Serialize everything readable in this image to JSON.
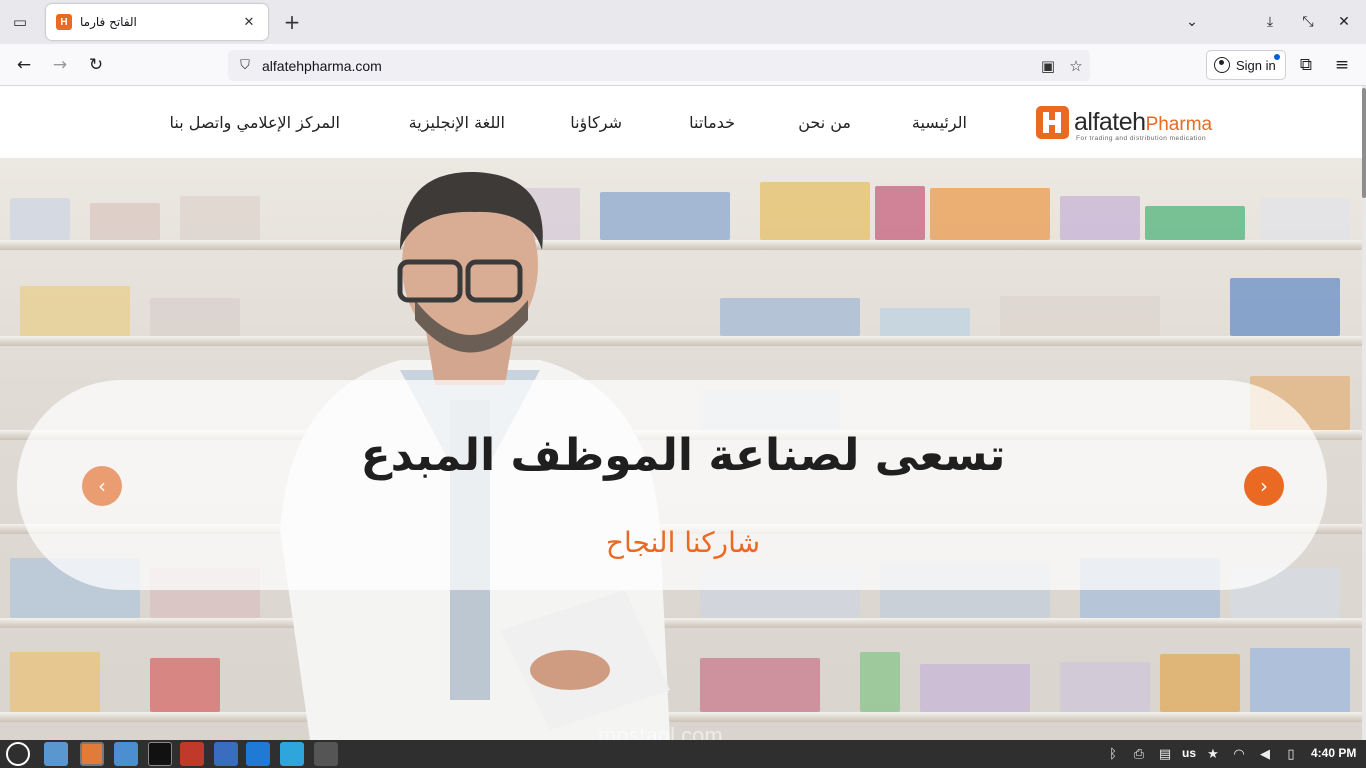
{
  "browser": {
    "tab": {
      "title": "الفاتح فارما",
      "favicon_letter": "H"
    },
    "url": "alfatehpharma.com",
    "signin_label": "Sign in"
  },
  "site": {
    "logo": {
      "word1": "alfateh",
      "word2": "Pharma",
      "tagline": "For trading and distribution medication"
    },
    "menu": [
      {
        "label": "الرئيسية"
      },
      {
        "label": "من نحن"
      },
      {
        "label": "خدماتنا"
      },
      {
        "label": "شركاؤنا"
      },
      {
        "label": "اللغة الإنجليزية"
      },
      {
        "label": "المركز الإعلامي واتصل بنا"
      }
    ],
    "hero": {
      "title": "تسعى لصناعة الموظف المبدع",
      "subtitle": "شاركنا النجاح"
    },
    "watermark": "mostaql.com",
    "accent_color": "#ea6a24"
  },
  "taskbar": {
    "keyboard_layout": "us",
    "clock": "4:40 PM"
  }
}
